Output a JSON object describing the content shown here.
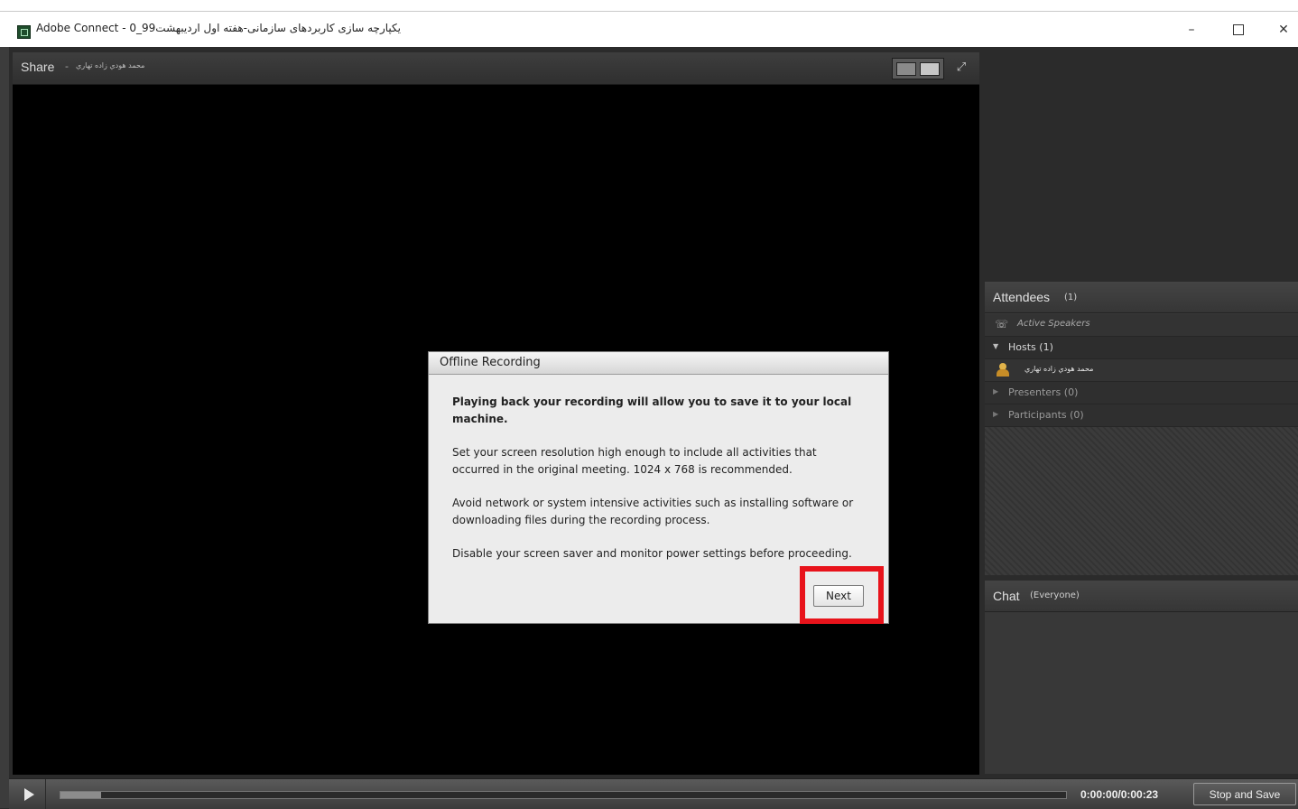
{
  "window": {
    "title": "يكپارچه سازی کاربردهای سازمانی-هفته اول اردیبهشت99_0 - Adobe Connect",
    "minimize_glyph": "–",
    "close_glyph": "✕"
  },
  "share_pod": {
    "title": "Share",
    "separator": "-",
    "presenter": "محمد هودي زاده تهاري"
  },
  "attendees_pod": {
    "title": "Attendees",
    "count": "(1)",
    "active_speakers": "Active Speakers",
    "hosts_label": "Hosts (1)",
    "host_name": "محمد هودي زاده تهاري",
    "presenters_label": "Presenters (0)",
    "participants_label": "Participants (0)"
  },
  "chat_pod": {
    "title": "Chat",
    "scope": "(Everyone)"
  },
  "dialog": {
    "title": "Offline Recording",
    "p1": "Playing back your recording will allow you to save it to your local machine.",
    "p2": "Set your screen resolution high enough to include all activities that occurred in the original meeting. 1024 x 768 is recommended.",
    "p3": "Avoid network or system intensive activities such as installing software or downloading files during the recording process.",
    "p4": "Disable your screen saver and monitor power settings before proceeding.",
    "next_label": "Next"
  },
  "playback": {
    "time": "0:00:00/0:00:23",
    "progress_fraction": 0.04,
    "stop_save_label": "Stop and Save"
  },
  "colors": {
    "highlight": "#e8131b",
    "pod_background": "#3a3a3a",
    "share_background": "#000000"
  }
}
